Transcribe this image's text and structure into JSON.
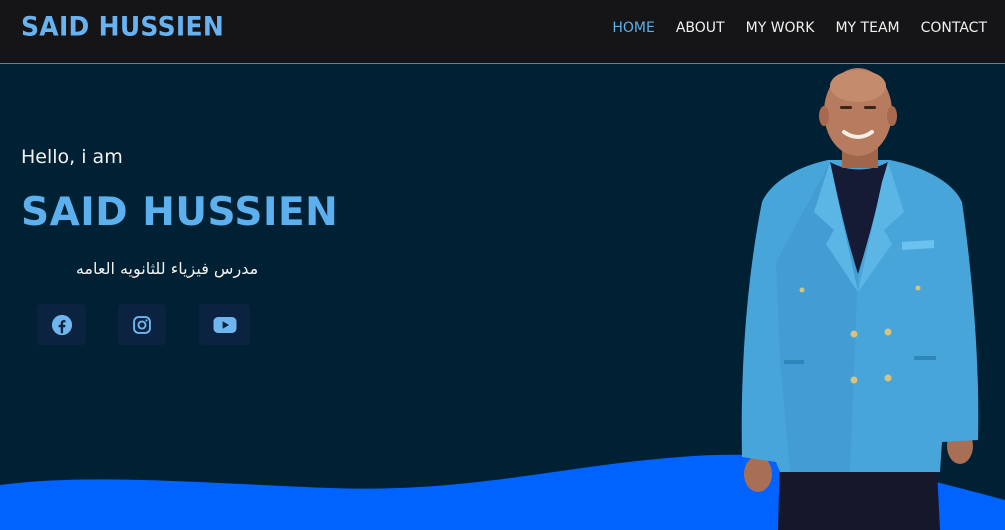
{
  "header": {
    "logo": "SAID HUSSIEN",
    "nav": [
      {
        "label": "HOME",
        "active": true
      },
      {
        "label": "ABOUT",
        "active": false
      },
      {
        "label": "MY WORK",
        "active": false
      },
      {
        "label": "MY TEAM",
        "active": false
      },
      {
        "label": "CONTACT",
        "active": false
      }
    ]
  },
  "hero": {
    "greeting": "Hello, i am",
    "name": "SAID HUSSIEN",
    "subtitle": "مدرس فيزياء للثانويه العامه",
    "social": [
      {
        "icon": "facebook-icon"
      },
      {
        "icon": "instagram-icon"
      },
      {
        "icon": "youtube-icon"
      }
    ]
  },
  "colors": {
    "header_bg": "#151416",
    "page_bg": "#002033",
    "accent": "#5cb0ee",
    "wave": "#0062ff"
  }
}
